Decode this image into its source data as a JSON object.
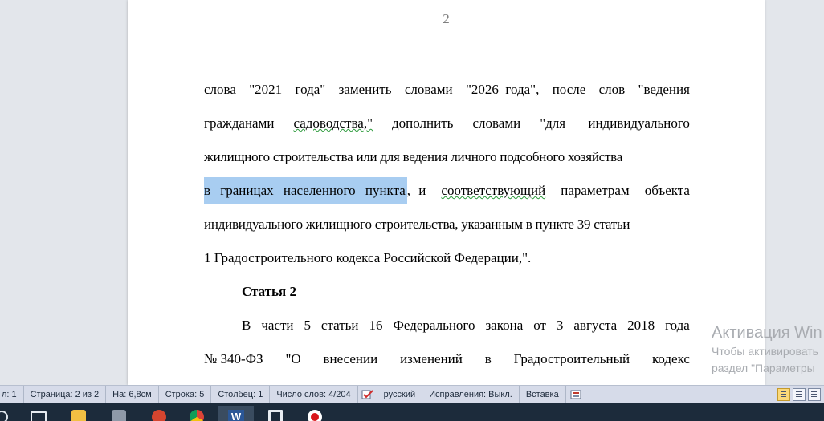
{
  "document": {
    "page_number": "2",
    "lines": [
      [
        "слова",
        "\"2021",
        "года\"",
        "заменить",
        "словами",
        "\"2026  года\",",
        "после",
        "слов",
        "\"ведения"
      ],
      [
        "гражданами",
        "садоводства,\"",
        "дополнить",
        "словами",
        "\"для ",
        "индивидуального"
      ],
      [
        "жилищного строительства или для ведения личного подсобного хозяйства"
      ],
      [
        "в границах населенного пункта",
        ", и",
        "соответствующий",
        "параметрам",
        "объекта"
      ],
      [
        "индивидуального жилищного строительства, указанным в пункте 39 статьи"
      ],
      [
        "1 Градостроительного кодекса Российской Федерации,\"."
      ],
      [
        "Статья 2"
      ],
      [
        "В",
        "части",
        "5",
        "статьи",
        "16",
        "Федерального",
        "закона",
        "от",
        "3",
        "августа",
        "2018",
        "года"
      ],
      [
        "№ 340-ФЗ",
        "\"О",
        "внесении",
        "изменений",
        "в",
        "Градостроительный",
        "кодекс"
      ]
    ]
  },
  "watermark": {
    "title": "Активация Win",
    "line1": "Чтобы активировать",
    "line2": "раздел \"Параметры"
  },
  "statusbar": {
    "section": "л: 1",
    "page": "Страница: 2 из 2",
    "position": "На: 6,8см",
    "row": "Строка: 5",
    "column": "Столбец: 1",
    "word_count": "Число слов: 4/204",
    "language": "русский",
    "track_changes": "Исправления: Выкл.",
    "insert_mode": "Вставка"
  },
  "colors": {
    "selection": "#a8cdf1",
    "statusbar": "#d6dbe9",
    "taskbar": "#1c2b3b"
  }
}
